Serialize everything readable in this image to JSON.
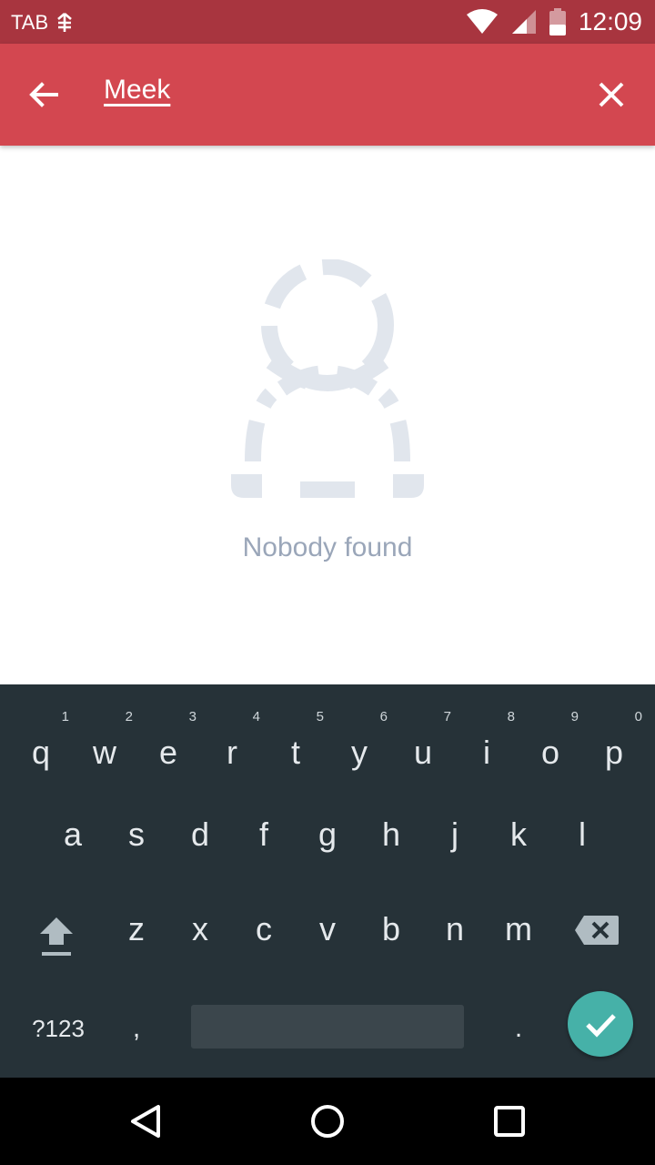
{
  "status_bar": {
    "carrier": "TAB",
    "time": "12:09",
    "icons": [
      "signal-extra-icon",
      "wifi-icon",
      "cell-signal-icon",
      "battery-icon"
    ]
  },
  "app_bar": {
    "back_icon": "arrow-left-icon",
    "search_value": "Meek",
    "clear_icon": "close-icon",
    "color": "#d34750"
  },
  "empty_state": {
    "icon": "person-dashed-icon",
    "message": "Nobody found",
    "color": "#9aa6b9"
  },
  "keyboard": {
    "row1": [
      {
        "key": "q",
        "hint": "1"
      },
      {
        "key": "w",
        "hint": "2"
      },
      {
        "key": "e",
        "hint": "3"
      },
      {
        "key": "r",
        "hint": "4"
      },
      {
        "key": "t",
        "hint": "5"
      },
      {
        "key": "y",
        "hint": "6"
      },
      {
        "key": "u",
        "hint": "7"
      },
      {
        "key": "i",
        "hint": "8"
      },
      {
        "key": "o",
        "hint": "9"
      },
      {
        "key": "p",
        "hint": "0"
      }
    ],
    "row2": [
      "a",
      "s",
      "d",
      "f",
      "g",
      "h",
      "j",
      "k",
      "l"
    ],
    "row3": [
      "z",
      "x",
      "c",
      "v",
      "b",
      "n",
      "m"
    ],
    "symbols_label": "?123",
    "comma": ",",
    "period": ".",
    "shift_icon": "shift-icon",
    "backspace_icon": "backspace-icon",
    "enter_icon": "checkmark-icon",
    "background": "#263238",
    "enter_color": "#46b1a8"
  },
  "nav_bar": {
    "back_icon": "nav-back-icon",
    "home_icon": "nav-home-icon",
    "recents_icon": "nav-recents-icon"
  }
}
